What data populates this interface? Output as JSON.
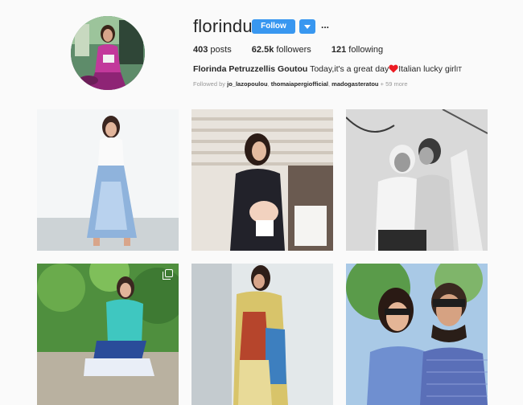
{
  "profile": {
    "username": "florindu",
    "follow_label": "Follow",
    "more_label": "...",
    "stats": {
      "posts_count": "403",
      "posts_label": "posts",
      "followers_count": "62.5k",
      "followers_label": "followers",
      "following_count": "121",
      "following_label": "following"
    },
    "bio": {
      "full_name": "Florinda Petruzzellis Goutou",
      "text_before": "Today,it's a great day",
      "text_after": "Italian lucky girl",
      "country_flag": "IT",
      "emoji_icon": "red-heart-icon"
    },
    "followed_by": {
      "prefix": "Followed by",
      "accounts": [
        "jo_lazopoulou",
        "thomaiapergiofficial",
        "madogasteratou"
      ],
      "suffix": "+ 59 more"
    }
  },
  "posts": [
    {
      "id": "post-1",
      "description_icon": "photo",
      "multi": false
    },
    {
      "id": "post-2",
      "description_icon": "photo",
      "multi": false
    },
    {
      "id": "post-3",
      "description_icon": "photo",
      "multi": false
    },
    {
      "id": "post-4",
      "description_icon": "photo",
      "multi": true
    },
    {
      "id": "post-5",
      "description_icon": "photo",
      "multi": false
    },
    {
      "id": "post-6",
      "description_icon": "photo",
      "multi": false
    }
  ],
  "colors": {
    "accent": "#3897f0",
    "text": "#262626",
    "muted": "#999999",
    "background": "#fafafa",
    "heart": "#ed1c24"
  }
}
